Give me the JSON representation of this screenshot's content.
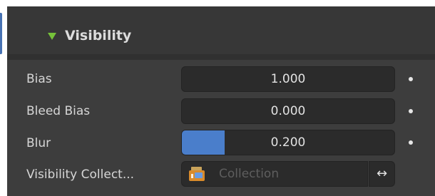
{
  "panel": {
    "title": "Visibility",
    "expanded": true
  },
  "rows": [
    {
      "label": "Bias",
      "value": "1.000",
      "slider_fraction": 0.0
    },
    {
      "label": "Bleed Bias",
      "value": "0.000",
      "slider_fraction": 0.0
    },
    {
      "label": "Blur",
      "value": "0.200",
      "slider_fraction": 0.2
    }
  ],
  "visibility_collection": {
    "label": "Visibility Collect...",
    "placeholder": "Collection",
    "icon": "collection-icon",
    "swap_icon": "swap-arrows-icon"
  },
  "colors": {
    "accent_blue": "#4a7ecb",
    "triangle_green": "#76c23a"
  }
}
